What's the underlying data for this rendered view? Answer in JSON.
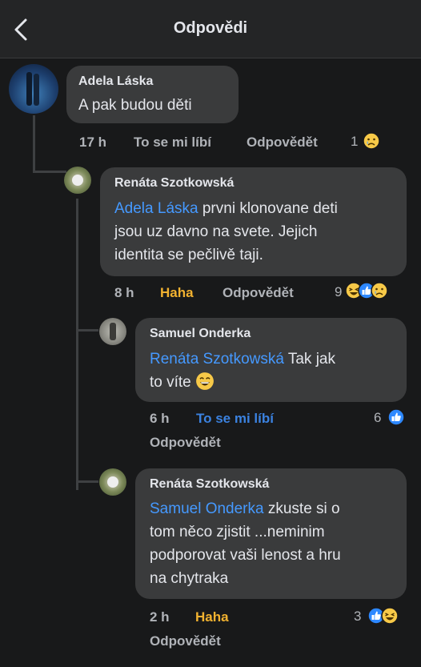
{
  "header": {
    "title": "Odpovědi",
    "back_icon": "chevron-left-icon"
  },
  "comments": [
    {
      "name": "Adela Láska",
      "text": "A pak budou děti",
      "time": "17 h",
      "like_label": "To se mi líbí",
      "reply_label": "Odpovědět",
      "reaction_count": "1",
      "reactions": [
        "sad-emoji-icon"
      ]
    },
    {
      "name": "Renáta Szotkowská",
      "mention": "Adela Láska",
      "text_lines": [
        "prvni klonovane deti",
        "jsou uz davno na svete. Jejich",
        "identita se pečlivě taji."
      ],
      "time": "8 h",
      "like_label": "Haha",
      "reply_label": "Odpovědět",
      "reaction_count": "9",
      "reactions": [
        "haha-emoji-icon",
        "like-icon",
        "sad-emoji-icon"
      ]
    },
    {
      "name": "Samuel Onderka",
      "mention": "Renáta Szotkowská",
      "text_lines": [
        "Tak jak",
        "to víte"
      ],
      "time": "6 h",
      "like_label": "To se mi líbí",
      "reply_label": "Odpovědět",
      "reaction_count": "6",
      "reactions": [
        "like-icon"
      ]
    },
    {
      "name": "Renáta Szotkowská",
      "mention": "Samuel Onderka",
      "text_lines": [
        "zkuste si o",
        "tom něco zjistit ...neminim",
        "podporovat vaši lenost a hru",
        "na chytraka"
      ],
      "time": "2 h",
      "like_label": "Haha",
      "reply_label": "Odpovědět",
      "reaction_count": "3",
      "reactions": [
        "like-icon",
        "haha-emoji-icon"
      ]
    }
  ]
}
